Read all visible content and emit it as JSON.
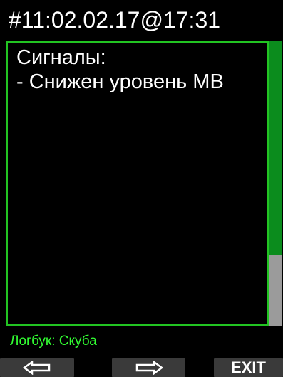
{
  "header": {
    "title": "#11:02.02.17@17:31"
  },
  "panel": {
    "line1": "Сигналы:",
    "line2": "- Снижен уровень МВ"
  },
  "scrollbar": {
    "position_fraction": 0.0,
    "visible_fraction": 0.75,
    "thumb_color": "#0b8c1d",
    "track_color": "#9b9b9b"
  },
  "status": {
    "text": "Логбук: Скуба",
    "color": "#32ff32"
  },
  "softkeys": {
    "left_icon": "arrow-left-icon",
    "right_icon": "arrow-right-icon",
    "exit_label": "EXIT"
  },
  "colors": {
    "border": "#22c422",
    "background": "#000000",
    "softkey_bg": "#3a3a3a"
  }
}
